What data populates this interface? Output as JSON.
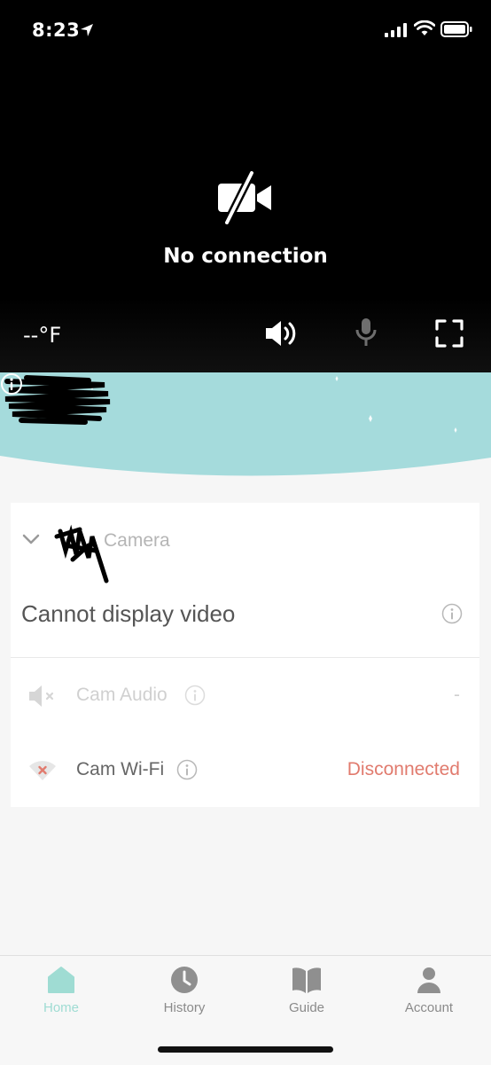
{
  "status_bar": {
    "time": "8:23",
    "icons": [
      "location-arrow-icon",
      "cellular-signal-icon",
      "wifi-icon",
      "battery-icon"
    ]
  },
  "video": {
    "icon": "video-off-icon",
    "message": "No connection",
    "temperature": "--°F",
    "controls": [
      "speaker-icon",
      "microphone-icon",
      "fullscreen-icon"
    ]
  },
  "banner": {
    "color": "#a5dbdc",
    "icon": "info-icon"
  },
  "camera_card": {
    "camera_label": "Camera",
    "status_text": "Cannot display video",
    "rows": [
      {
        "label": "Cam Audio",
        "value": "-",
        "icon": "speaker-muted-icon"
      },
      {
        "label": "Cam Wi-Fi",
        "value": "Disconnected",
        "icon": "wifi-disconnected-icon"
      }
    ],
    "accent_color": "#e17b6e"
  },
  "tabbar": {
    "active_color": "#9fdcd3",
    "tabs": [
      {
        "label": "Home",
        "icon": "home-icon",
        "active": true
      },
      {
        "label": "History",
        "icon": "clock-icon",
        "active": false
      },
      {
        "label": "Guide",
        "icon": "book-icon",
        "active": false
      },
      {
        "label": "Account",
        "icon": "user-icon",
        "active": false
      }
    ]
  }
}
